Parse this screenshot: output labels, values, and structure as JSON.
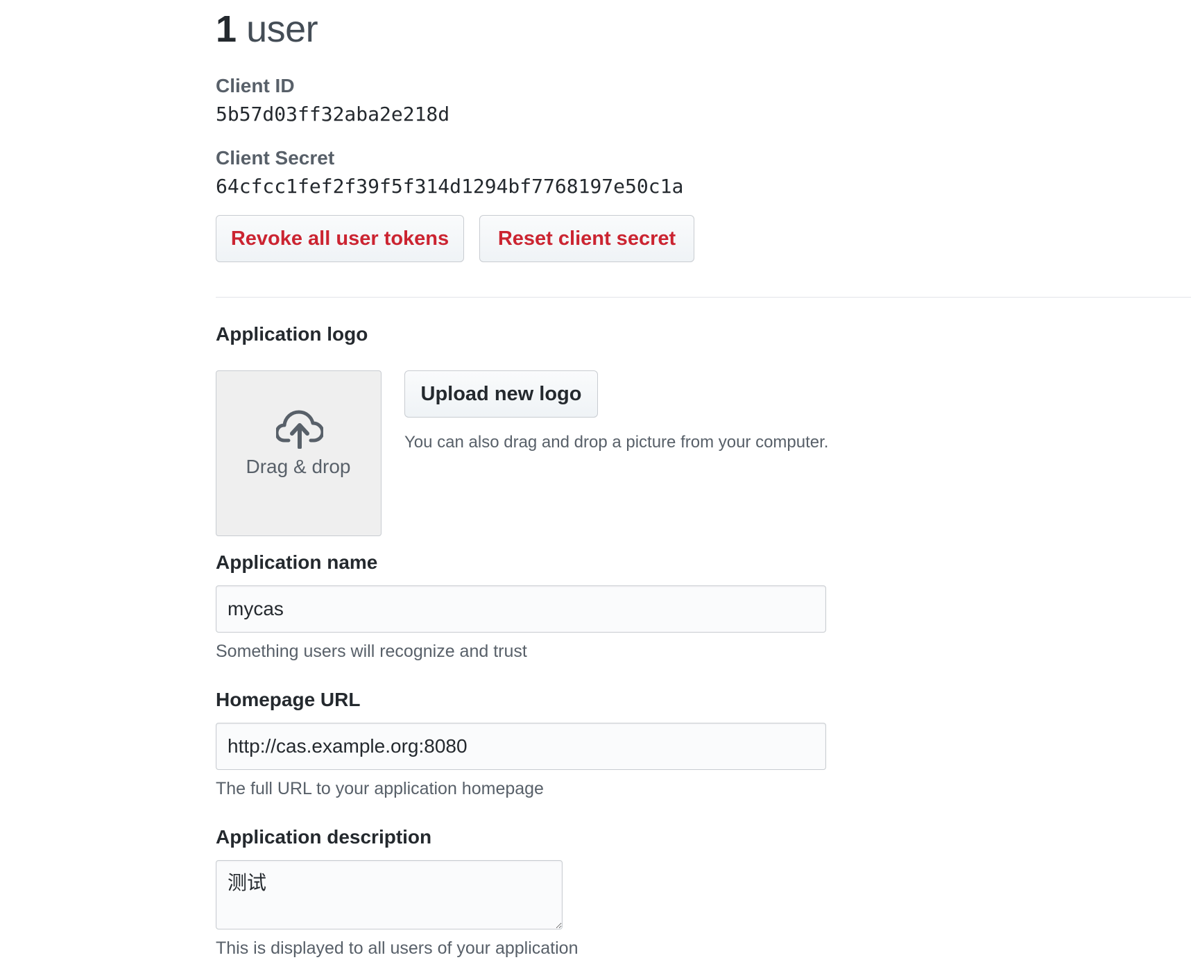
{
  "header": {
    "user_count": "1",
    "user_word": "user"
  },
  "credentials": {
    "client_id_label": "Client ID",
    "client_id": "5b57d03ff32aba2e218d",
    "client_secret_label": "Client Secret",
    "client_secret": "64cfcc1fef2f39f5f314d1294bf7768197e50c1a"
  },
  "actions": {
    "revoke_label": "Revoke all user tokens",
    "reset_label": "Reset client secret"
  },
  "logo": {
    "section_label": "Application logo",
    "dropzone_text": "Drag & drop",
    "dropzone_icon": "cloud-upload-icon",
    "upload_label": "Upload new logo",
    "upload_note": "You can also drag and drop a picture from your computer."
  },
  "app_name": {
    "label": "Application name",
    "value": "mycas",
    "hint": "Something users will recognize and trust"
  },
  "homepage": {
    "label": "Homepage URL",
    "value": "http://cas.example.org:8080",
    "hint": "The full URL to your application homepage"
  },
  "description": {
    "label": "Application description",
    "value": "测试",
    "hint": "This is displayed to all users of your application"
  },
  "colors": {
    "danger": "#cb2431",
    "text": "#24292e",
    "muted": "#586069",
    "border": "#c8ccd1"
  }
}
